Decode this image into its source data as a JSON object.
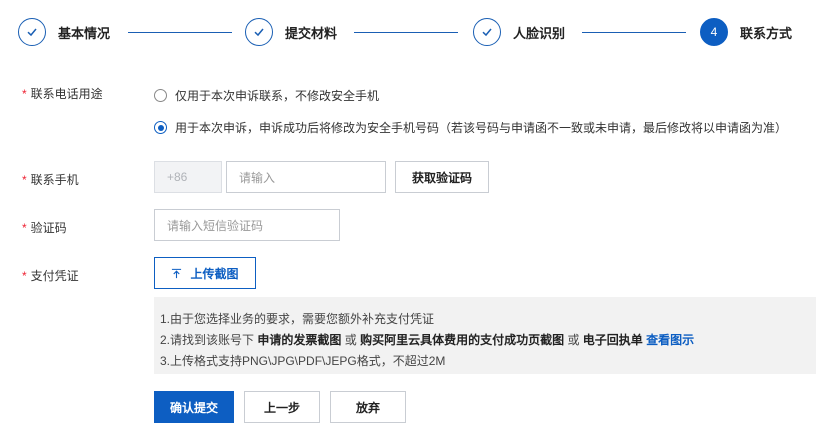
{
  "steps": [
    {
      "label": "基本情况",
      "state": "done"
    },
    {
      "label": "提交材料",
      "state": "done"
    },
    {
      "label": "人脸识别",
      "state": "done"
    },
    {
      "label": "联系方式",
      "state": "active",
      "number": "4"
    }
  ],
  "form": {
    "required_mark": "*",
    "purpose": {
      "label": "联系电话用途",
      "options": [
        {
          "text": "仅用于本次申诉联系，不修改安全手机",
          "checked": false
        },
        {
          "text": "用于本次申诉，申诉成功后将修改为安全手机号码（若该号码与申请函不一致或未申请，最后修改将以申请函为准）",
          "checked": true
        }
      ]
    },
    "phone": {
      "label": "联系手机",
      "country_code": "+86",
      "placeholder": "请输入",
      "get_code_button": "获取验证码"
    },
    "code": {
      "label": "验证码",
      "placeholder": "请输入短信验证码"
    },
    "payment": {
      "label": "支付凭证",
      "upload_button": "上传截图"
    },
    "notice": {
      "line1": "1.由于您选择业务的要求，需要您额外补充支付凭证",
      "line2_prefix": "2.请找到该账号下",
      "line2_bold1": "申请的发票截图",
      "line2_or1": "或",
      "line2_bold2": "购买阿里云具体费用的支付成功页截图",
      "line2_or2": "或",
      "line2_bold3": "电子回执单",
      "line2_link": "查看图示",
      "line3": "3.上传格式支持PNG\\JPG\\PDF\\JEPG格式，不超过2M"
    }
  },
  "actions": {
    "submit": "确认提交",
    "previous": "上一步",
    "abandon": "放弃"
  },
  "colors": {
    "primary": "#0d5ec2",
    "required": "#e23333"
  }
}
